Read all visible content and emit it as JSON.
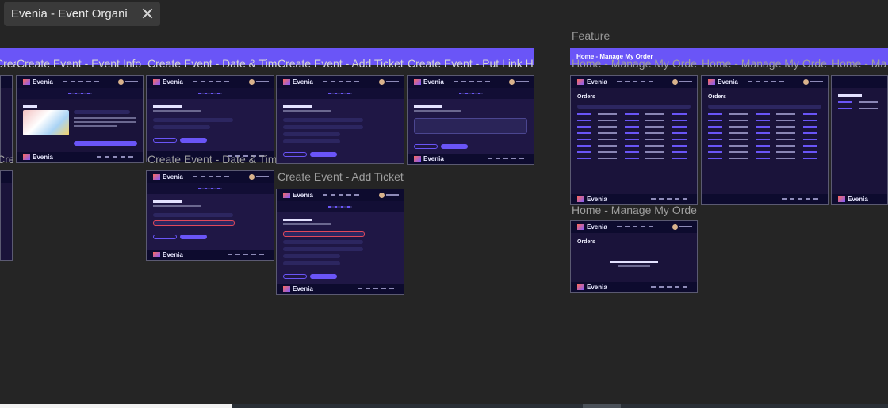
{
  "tab": {
    "title": "Evenia - Event Organi"
  },
  "sections": {
    "feature": "Feature"
  },
  "bands": {
    "left_labels": [
      "Create Event - Event Info",
      "Create Event - Event Info",
      "Create Event - Date & Tim",
      "Create Event - Add Ticket",
      "Create Event - Put Link H"
    ],
    "right_label": "Home - Manage My Order"
  },
  "frame_labels": {
    "row1_right": [
      "Home - Manage My Orde",
      "Home - Manage My Orde",
      "Home - Ma"
    ],
    "row2_left_info": "Create Event - Event Info",
    "row2_date": "Create Event - Date & Tim",
    "row2_ticket": "Create Event - Add Ticket",
    "row2_orders": "Home - Manage My Orde"
  },
  "brand": "Evenia",
  "screens": {
    "orders_title": "Orders"
  },
  "colors": {
    "accent": "#6a55f7",
    "canvas": "#252525",
    "screen_bg": "#1a133a",
    "nav_bg": "#0d0b2e"
  }
}
